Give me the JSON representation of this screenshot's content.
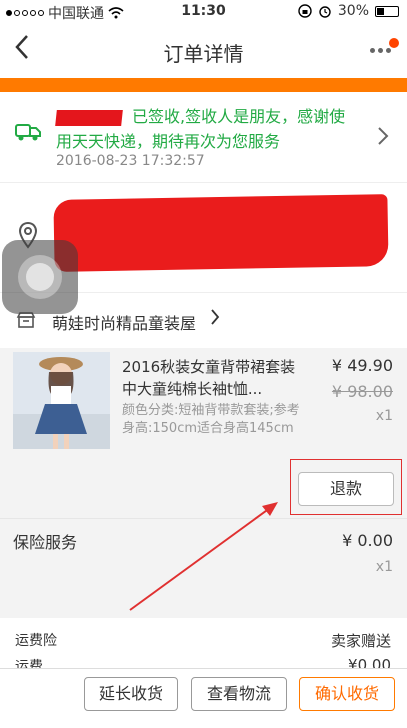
{
  "status_bar": {
    "carrier": "中国联通",
    "time": "11:30",
    "battery": "30%"
  },
  "nav": {
    "title": "订单详情"
  },
  "logistics": {
    "message": "已签收,签收人是朋友，感谢使用天天快递，期待再次为您服务",
    "time": "2016-08-23 17:32:57"
  },
  "shop": {
    "name": "萌娃时尚精品童装屋"
  },
  "product": {
    "title": "2016秋装女童背带裙套装 中大童纯棉长袖t恤...",
    "spec": "颜色分类:短袖背带款套装;参考身高:150cm适合身高145cm",
    "price": "¥ 49.90",
    "original_price": "¥ 98.00",
    "quantity": "x1",
    "refund_label": "退款"
  },
  "insurance": {
    "label": "保险服务",
    "price": "¥ 0.00",
    "quantity": "x1"
  },
  "fees": {
    "shipping_insurance_label": "运费险",
    "shipping_insurance_value": "卖家赠送",
    "shipping_label": "运费",
    "shipping_value": "¥0.00"
  },
  "actions": {
    "extend": "延长收货",
    "track": "查看物流",
    "confirm": "确认收货"
  },
  "colors": {
    "accent_orange": "#ff7a00",
    "logistics_green": "#22aa44",
    "annotation_red": "#e03030"
  }
}
